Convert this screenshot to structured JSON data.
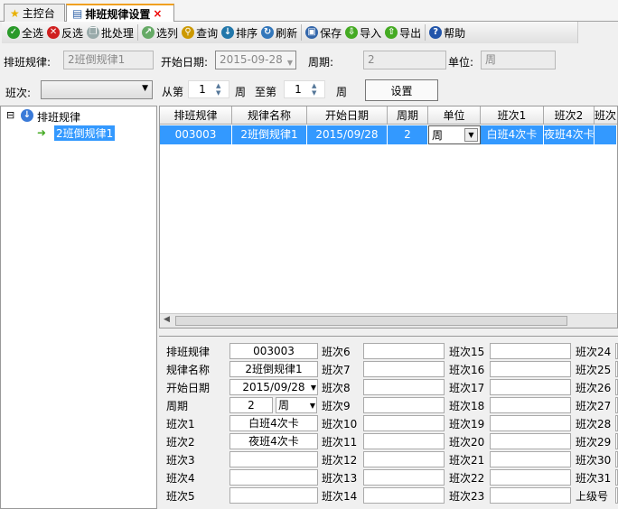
{
  "tabs": [
    {
      "label": "主控台",
      "icon": "star-icon"
    },
    {
      "label": "排班规律设置",
      "icon": "list-icon",
      "close": "×"
    }
  ],
  "toolbar": [
    {
      "label": "全选",
      "icon": "check-icon",
      "color": "#2a9a2a",
      "glyph": "✓"
    },
    {
      "label": "反选",
      "icon": "x-icon",
      "color": "#d02020",
      "glyph": "✕"
    },
    {
      "label": "批处理",
      "icon": "copy-icon",
      "color": "#9aa",
      "glyph": "❐"
    },
    {
      "label": "选列",
      "icon": "pick-column-icon",
      "color": "#6a6",
      "glyph": "↗"
    },
    {
      "label": "查询",
      "icon": "search-icon",
      "color": "#c90",
      "glyph": "⚲"
    },
    {
      "label": "排序",
      "icon": "sort-icon",
      "color": "#27a",
      "glyph": "↓"
    },
    {
      "label": "刷新",
      "icon": "refresh-icon",
      "color": "#37b",
      "glyph": "↻"
    },
    {
      "label": "保存",
      "icon": "save-icon",
      "color": "#36a",
      "glyph": "▣"
    },
    {
      "label": "导入",
      "icon": "import-arrow-down-icon",
      "color": "#4a2",
      "glyph": "⇩"
    },
    {
      "label": "导出",
      "icon": "export-arrow-up-icon",
      "color": "#4a2",
      "glyph": "⇧"
    },
    {
      "label": "帮助",
      "icon": "help-icon",
      "color": "#2255aa",
      "glyph": "?"
    }
  ],
  "filter": {
    "rule_label": "排班规律:",
    "rule_value": "2班倒规律1",
    "start_label": "开始日期:",
    "start_value": "2015-09-28",
    "period_label": "周期:",
    "period_value": "2",
    "unit_label": "单位:",
    "unit_value": "周",
    "shift_label": "班次:",
    "shift_value": "",
    "from_label": "从第",
    "from_value": "1",
    "week1": "周",
    "to_label": "至第",
    "to_value": "1",
    "week2": "周",
    "set_button": "设置"
  },
  "tree": {
    "root": "排班规律",
    "child": "2班倒规律1",
    "toggle": "⊟"
  },
  "grid": {
    "columns": [
      "排班规律",
      "规律名称",
      "开始日期",
      "周期",
      "单位",
      "班次1",
      "班次2",
      "班次"
    ],
    "rows": [
      [
        "003003",
        "2班倒规律1",
        "2015/09/28",
        "2",
        "周",
        "白班4次卡",
        "夜班4次卡",
        ""
      ]
    ]
  },
  "form": {
    "col1": [
      {
        "label": "排班规律",
        "value": "003003"
      },
      {
        "label": "规律名称",
        "value": "2班倒规律1"
      },
      {
        "label": "开始日期",
        "value": "2015/09/28"
      },
      {
        "label": "周期",
        "value": "2",
        "unit": "周"
      },
      {
        "label": "班次1",
        "value": "白班4次卡"
      },
      {
        "label": "班次2",
        "value": "夜班4次卡"
      },
      {
        "label": "班次3",
        "value": ""
      },
      {
        "label": "班次4",
        "value": ""
      },
      {
        "label": "班次5",
        "value": ""
      }
    ],
    "col2": [
      "班次6",
      "班次7",
      "班次8",
      "班次9",
      "班次10",
      "班次11",
      "班次12",
      "班次13",
      "班次14"
    ],
    "col3": [
      "班次15",
      "班次16",
      "班次17",
      "班次18",
      "班次19",
      "班次20",
      "班次21",
      "班次22",
      "班次23"
    ],
    "col4": [
      "班次24",
      "班次25",
      "班次26",
      "班次27",
      "班次28",
      "班次29",
      "班次30",
      "班次31",
      "上级号"
    ]
  }
}
